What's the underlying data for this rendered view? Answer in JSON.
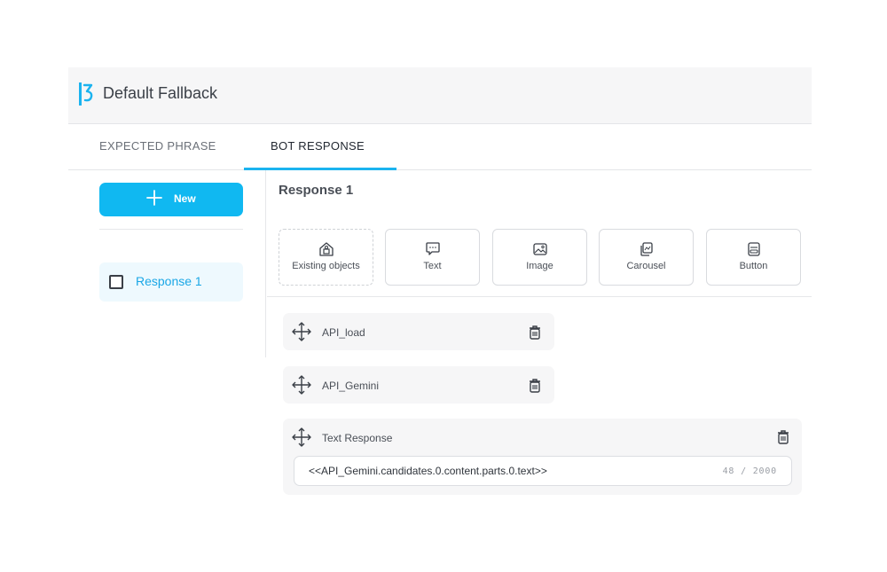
{
  "header": {
    "title": "Default Fallback",
    "accent_color": "#1bb3ef"
  },
  "tabs": [
    {
      "label": "EXPECTED PHRASE",
      "active": false
    },
    {
      "label": "BOT RESPONSE",
      "active": true
    }
  ],
  "sidebar": {
    "new_button_label": "New",
    "responses": [
      {
        "label": "Response 1",
        "checked": false
      }
    ]
  },
  "main": {
    "response_title": "Response 1",
    "response_types": [
      {
        "label": "Existing objects",
        "icon": "existing-objects-icon"
      },
      {
        "label": "Text",
        "icon": "chat-bubble-icon"
      },
      {
        "label": "Image",
        "icon": "image-icon"
      },
      {
        "label": "Carousel",
        "icon": "carousel-icon"
      },
      {
        "label": "Button",
        "icon": "button-icon"
      }
    ],
    "blocks": [
      {
        "name": "API_load"
      },
      {
        "name": "API_Gemini"
      },
      {
        "name": "Text Response",
        "value": "<<API_Gemini.candidates.0.content.parts.0.text>>",
        "counter": "48 / 2000"
      }
    ]
  }
}
